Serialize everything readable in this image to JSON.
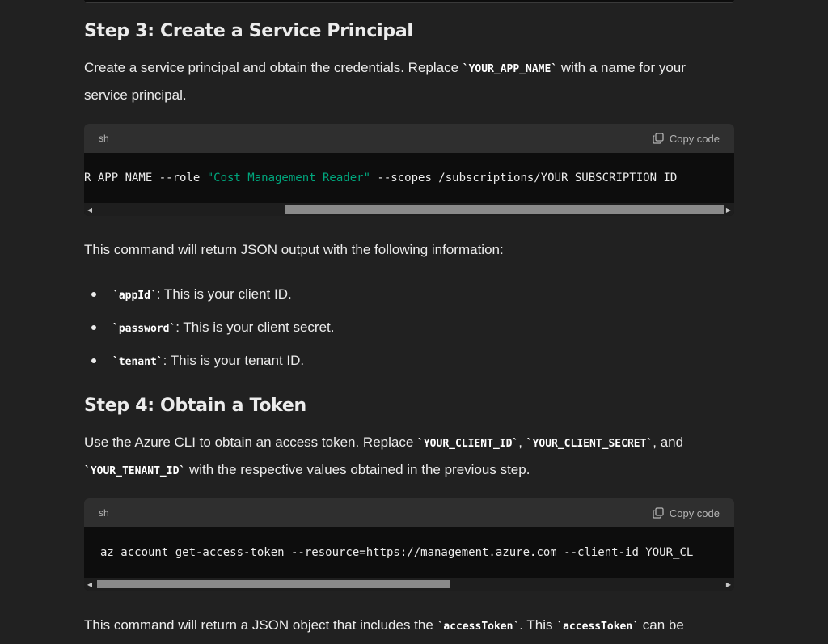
{
  "step3": {
    "title": "Step 3: Create a Service Principal",
    "para_before": "Create a service principal and obtain the credentials. Replace ",
    "para_code": "`YOUR_APP_NAME`",
    "para_after": " with a name for your service principal.",
    "code": {
      "lang": "sh",
      "copy_label": "Copy code",
      "line_pre": "R_APP_NAME --role ",
      "line_str": "\"Cost Management Reader\"",
      "line_post": " --scopes /subscriptions/YOUR_SUBSCRIPTION_ID",
      "scroll_position": 0.75
    },
    "result_text": "This command will return JSON output with the following information:",
    "bullets": [
      {
        "code": "`appId`",
        "text": ": This is your client ID."
      },
      {
        "code": "`password`",
        "text": ": This is your client secret."
      },
      {
        "code": "`tenant`",
        "text": ": This is your tenant ID."
      }
    ]
  },
  "step4": {
    "title": "Step 4: Obtain a Token",
    "para_1": "Use the Azure CLI to obtain an access token. Replace ",
    "para_code1": "`YOUR_CLIENT_ID`",
    "para_2": ", ",
    "para_code2": "`YOUR_CLIENT_SECRET`",
    "para_3": ", and ",
    "para_code3": "`YOUR_TENANT_ID`",
    "para_4": " with the respective values obtained in the previous step.",
    "code": {
      "lang": "sh",
      "copy_label": "Copy code",
      "line": "az account get-access-token --resource=https://management.azure.com --client-id YOUR_CL",
      "scroll_position": 0.0
    },
    "result_1": "This command will return a JSON object that includes the ",
    "result_code1": "`accessToken`",
    "result_2": ". This ",
    "result_code2": "`accessToken`",
    "result_3": " can be"
  },
  "icons": {
    "copy": "copy-icon",
    "left": "scroll-left-arrow-icon",
    "right": "scroll-right-arrow-icon"
  }
}
